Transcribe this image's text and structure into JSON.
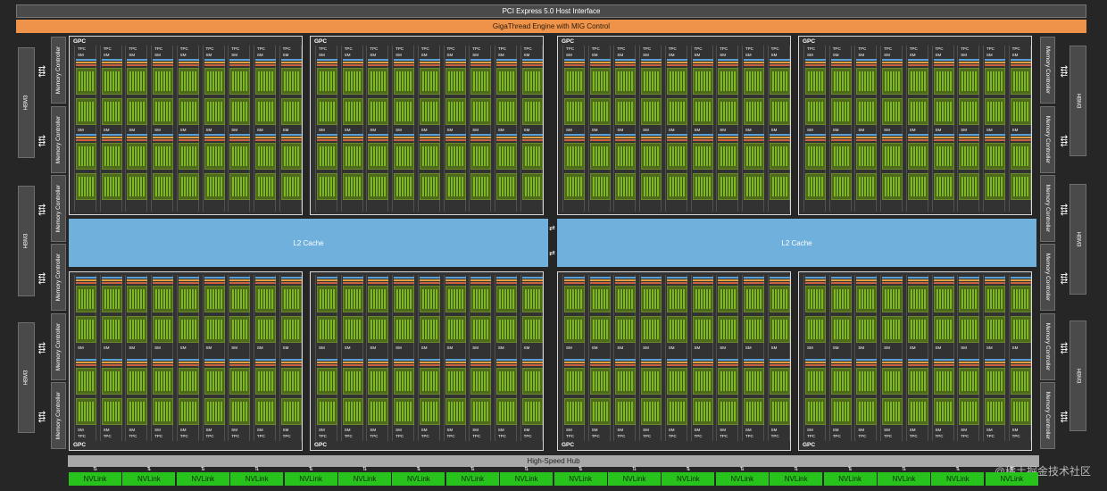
{
  "header": {
    "pcie": "PCI Express 5.0 Host Interface",
    "gigathread": "GigaThread Engine with MIG Control"
  },
  "memory": {
    "hbm_label": "HBM3",
    "mc_label": "Memory Controller",
    "left_hbm_count": 3,
    "right_hbm_count": 3,
    "left_mc_count": 6,
    "right_mc_count": 6
  },
  "cache": {
    "l2_left": "L2 Cache",
    "l2_right": "L2 Cache"
  },
  "gpc": {
    "label": "GPC",
    "tpc_label": "TPC",
    "sm_label": "SM",
    "count": 8,
    "tpc_per_gpc": 9
  },
  "hub": {
    "label": "High-Speed Hub"
  },
  "nvlink": {
    "label": "NVLink",
    "count": 18
  },
  "colors": {
    "background": "#262626",
    "pcie_bar": "#4a4a4a",
    "gigathread_bar": "#f0934a",
    "l2_cache": "#6fb1dc",
    "sm_core": "#7fb81e",
    "nvlink": "#27c21b",
    "hub": "#a9a9a9"
  },
  "icons": {
    "bidirectional_arrow": "bidirectional-arrow-icon"
  },
  "watermark": "@稀土掘金技术社区"
}
